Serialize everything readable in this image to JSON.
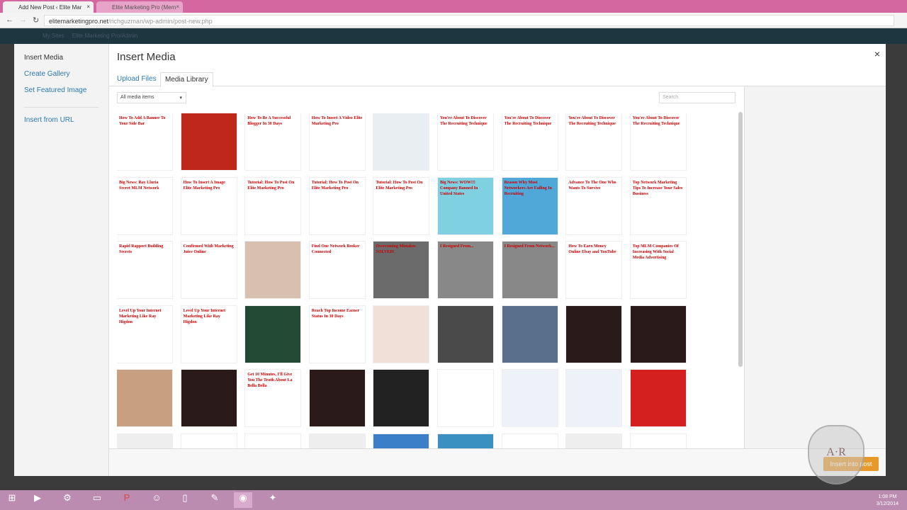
{
  "browser": {
    "tabs": [
      {
        "label": "Add New Post ‹ Elite Mar"
      },
      {
        "label": "Elite Marketing Pro (Mem"
      }
    ],
    "url_domain": "elitemarketingpro.net",
    "url_path": "/richguzman/wp-admin/post-new.php"
  },
  "wpbar": {
    "items": [
      "My Sites",
      "Elite Marketing Pro/Admin"
    ]
  },
  "modal": {
    "menu": [
      "Insert Media",
      "Create Gallery",
      "Set Featured Image",
      "Insert from URL"
    ],
    "title": "Insert Media",
    "close": "×",
    "tabs": [
      "Upload Files",
      "Media Library"
    ],
    "filter": "All media items",
    "search_placeholder": "Search",
    "insert_button": "Insert into post"
  },
  "thumbnails": [
    {
      "t": "How To Add A Banner To Your Side Bar",
      "c": "#fff"
    },
    {
      "t": "",
      "c": "#c0271b"
    },
    {
      "t": "How To Be A Successful Blogger In 30 Days",
      "c": "#fff"
    },
    {
      "t": "How To Insert A Video Elite Marketing Pro",
      "c": "#fff"
    },
    {
      "t": "",
      "c": "#e9eef2"
    },
    {
      "t": "You're About To Discover The Recruiting Technique",
      "c": "#fff"
    },
    {
      "t": "You're About To Discover The Recruiting Technique",
      "c": "#fff"
    },
    {
      "t": "You're About To Discover The Recruiting Technique",
      "c": "#fff"
    },
    {
      "t": "You're About To Discover The Recruiting Technique",
      "c": "#fff"
    },
    {
      "t": "Big News: Ray Lluria Secret MLM Network",
      "c": "#fff"
    },
    {
      "t": "How To Insert A Image Elite Marketing Pro",
      "c": "#fff"
    },
    {
      "t": "Tutorial: How To Post On Elite Marketing Pro",
      "c": "#fff"
    },
    {
      "t": "Tutorial: How To Post On Elite Marketing Pro",
      "c": "#fff"
    },
    {
      "t": "Tutorial: How To Post On Elite Marketing Pro",
      "c": "#fff"
    },
    {
      "t": "Big News: WOW!!! Company Banned In United States",
      "c": "#7fd0e0"
    },
    {
      "t": "Reason Why Most Networkers Are Failing In Recruiting",
      "c": "#4fa8d8"
    },
    {
      "t": "Advance To The One Who Wants To Survive",
      "c": "#fff"
    },
    {
      "t": "Top Network Marketing Tips To Increase Your Sales Business",
      "c": "#fff"
    },
    {
      "t": "Rapid Rapport Building Secrets",
      "c": "#fff"
    },
    {
      "t": "Confirmed With Marketing Juice Online",
      "c": "#fff"
    },
    {
      "t": "",
      "c": "#d8c0b0"
    },
    {
      "t": "Find One Network Broker Connected",
      "c": "#fff"
    },
    {
      "t": "Overcoming Mistakes SOLVED!",
      "c": "#6b6b6b"
    },
    {
      "t": "I Resigned From...",
      "c": "#888"
    },
    {
      "t": "I Resigned From Network...",
      "c": "#888"
    },
    {
      "t": "How To Earn Money Online Ebay and YouTube",
      "c": "#fff"
    },
    {
      "t": "Top MLM Companies Of Increasing With Social Media Advertising",
      "c": "#fff"
    },
    {
      "t": "Level Up Your Internet Marketing Like Ray Higdon",
      "c": "#fff"
    },
    {
      "t": "Level Up Your Internet Marketing Like Ray Higdon",
      "c": "#fff"
    },
    {
      "t": "",
      "c": "#234a35"
    },
    {
      "t": "Reach Top Income Earner Status In 30 Days",
      "c": "#fff"
    },
    {
      "t": "",
      "c": "#f0e0d8"
    },
    {
      "t": "",
      "c": "#4a4a4a"
    },
    {
      "t": "",
      "c": "#5a6f8c"
    },
    {
      "t": "",
      "c": "#2a1a1a"
    },
    {
      "t": "",
      "c": "#2a1a1a"
    },
    {
      "t": "",
      "c": "#c8a080"
    },
    {
      "t": "",
      "c": "#2a1a1a"
    },
    {
      "t": "Get 10 Minutes, I'll Give You The Truth About La Bella Bella",
      "c": "#fff"
    },
    {
      "t": "",
      "c": "#2a1a1a"
    },
    {
      "t": "",
      "c": "#222"
    },
    {
      "t": "",
      "c": "#fff"
    },
    {
      "t": "",
      "c": "#eef2f8"
    },
    {
      "t": "",
      "c": "#eef2f8"
    },
    {
      "t": "",
      "c": "#d52020"
    },
    {
      "t": "",
      "c": "#eee"
    },
    {
      "t": "",
      "c": "#fff"
    },
    {
      "t": "",
      "c": "#fff"
    },
    {
      "t": "",
      "c": "#eee"
    },
    {
      "t": "",
      "c": "#3a7fc8"
    },
    {
      "t": "",
      "c": "#3a90c0"
    },
    {
      "t": "",
      "c": "#fff"
    },
    {
      "t": "",
      "c": "#eee"
    },
    {
      "t": "",
      "c": "#fff"
    }
  ],
  "taskbar": {
    "time": "1:08 PM",
    "date": "3/12/2014"
  },
  "colors": {
    "accent": "#2a7ab0",
    "insert": "#e79a2a"
  }
}
